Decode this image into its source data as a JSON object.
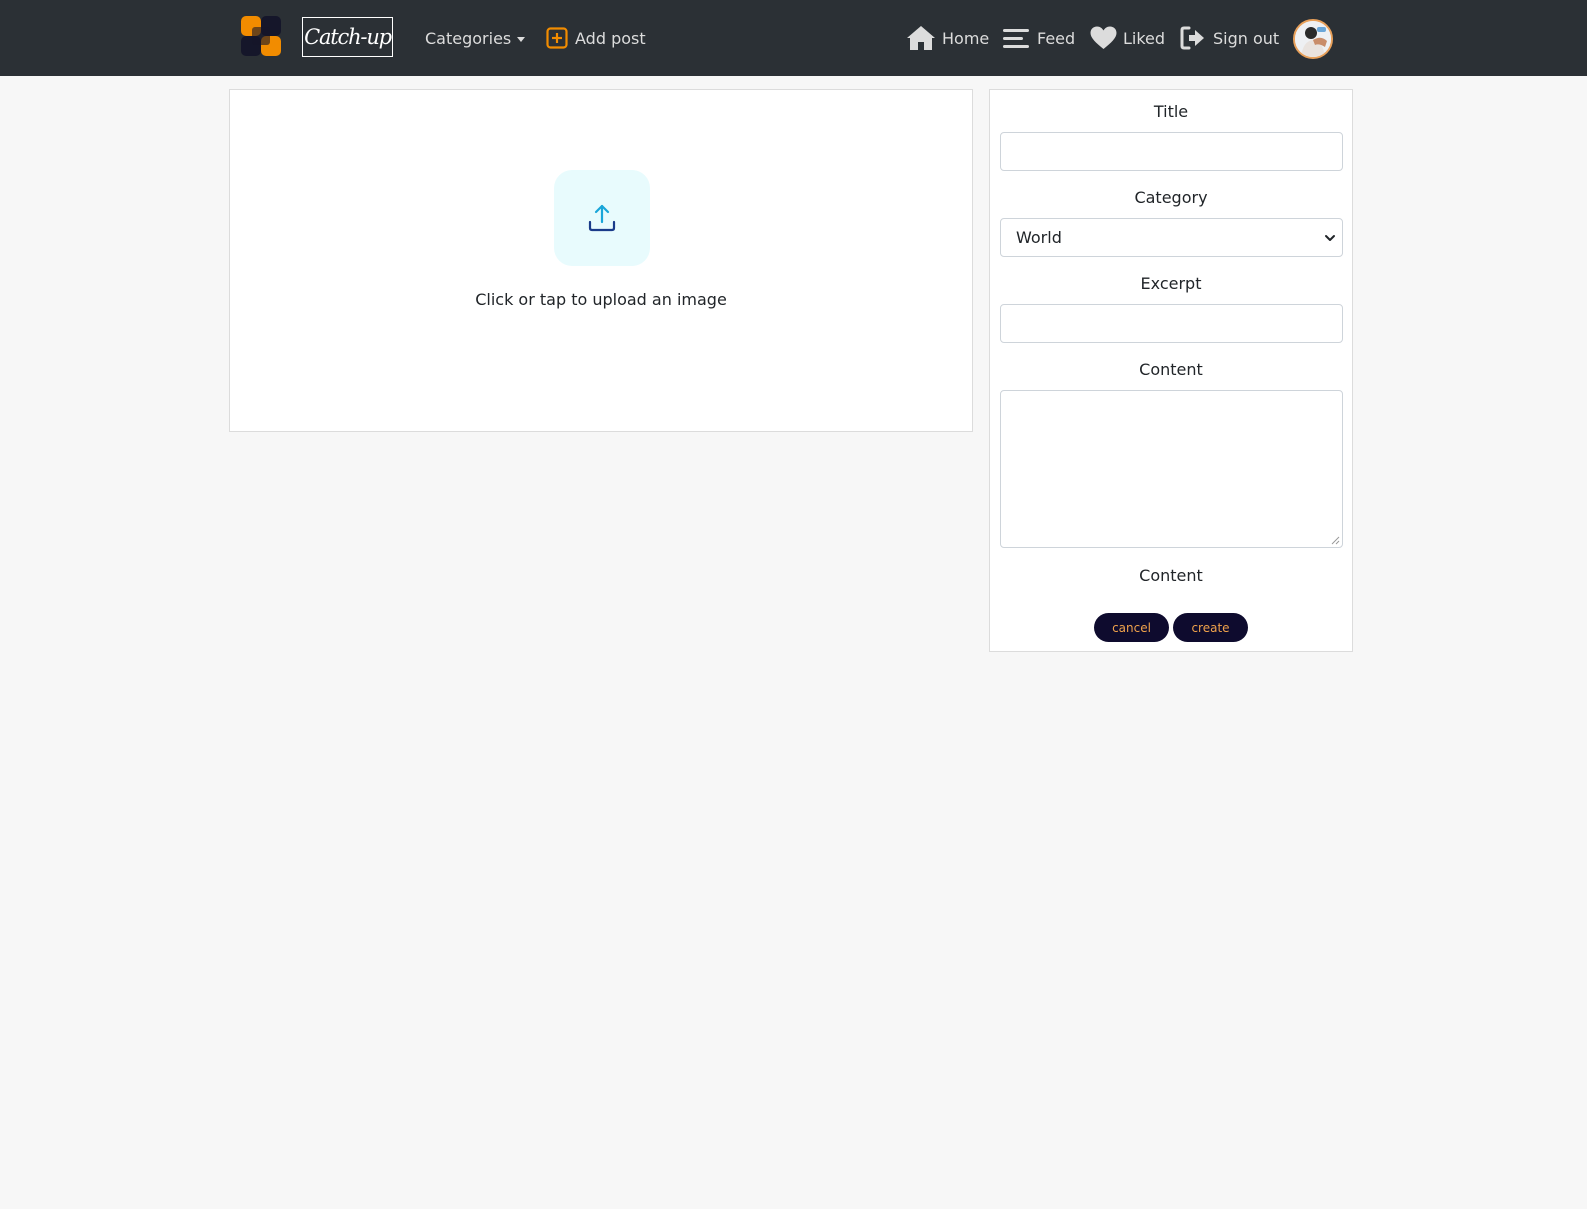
{
  "navbar": {
    "brand": "Catch-up",
    "categories_label": "Categories",
    "add_post_label": "Add post",
    "home_label": "Home",
    "feed_label": "Feed",
    "liked_label": "Liked",
    "signout_label": "Sign out"
  },
  "upload": {
    "text": "Click or tap to upload an image"
  },
  "form": {
    "title_label": "Title",
    "title_value": "",
    "category_label": "Category",
    "category_value": "World",
    "excerpt_label": "Excerpt",
    "excerpt_value": "",
    "content_label": "Content",
    "content_value": "",
    "content_label_2": "Content",
    "cancel_label": "cancel",
    "create_label": "create"
  },
  "colors": {
    "navbar_bg": "#2b3035",
    "accent_orange": "#f28c00",
    "button_bg": "#0e0b2e",
    "button_text": "#f0a24b",
    "upload_icon_bg": "#e8fbfd",
    "upload_arrow": "#1aa6d9"
  },
  "icons": {
    "logo": "logo-icon",
    "add_post": "plus-square-icon",
    "home": "home-icon",
    "feed": "bars-icon",
    "liked": "heart-icon",
    "signout": "sign-out-icon",
    "upload": "upload-icon"
  }
}
